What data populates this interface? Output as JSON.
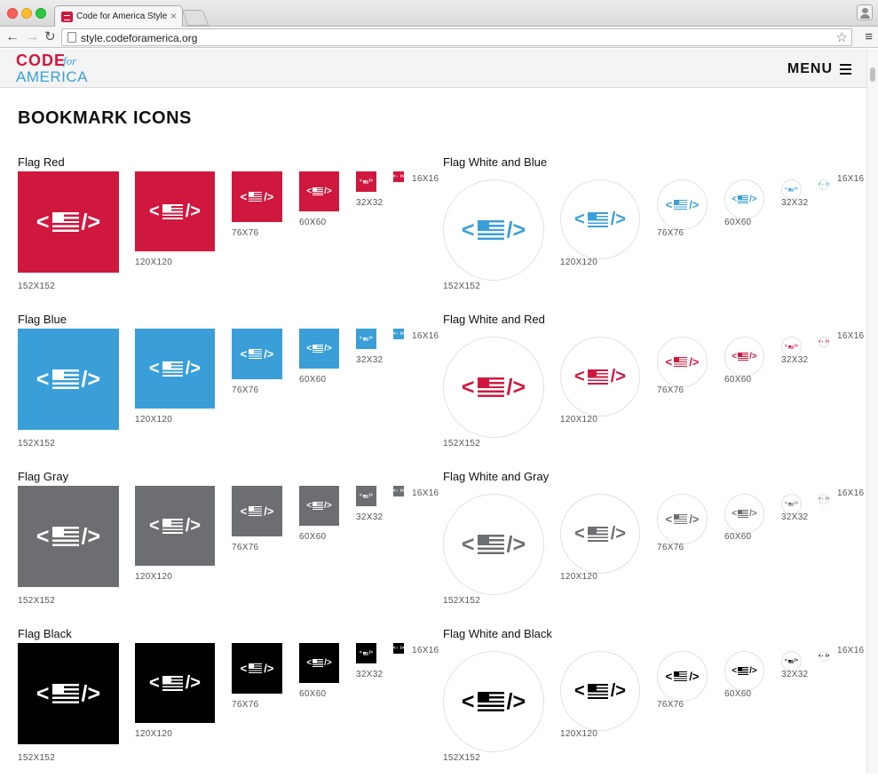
{
  "browser": {
    "tab_title": "Code for America Style Gu",
    "tab_close": "×",
    "url": "style.codeforamerica.org",
    "back": "←",
    "forward": "→",
    "reload": "↻",
    "star": "☆",
    "menu": "≡"
  },
  "site": {
    "logo_code": "CODE",
    "logo_for": "for",
    "logo_america": "AMERICA",
    "menu_label": "MENU"
  },
  "section_title": "BOOKMARK ICONS",
  "colors": {
    "red": "#d0183f",
    "blue": "#3a9fd8",
    "gray": "#6d6e71",
    "black": "#000000",
    "white": "#ffffff"
  },
  "sizes": [
    "152X152",
    "120X120",
    "76X76",
    "60X60",
    "32X32",
    "16X16"
  ],
  "groups": [
    {
      "id": "flag-red",
      "label": "Flag Red",
      "color": "#d0183f",
      "variant": "solid"
    },
    {
      "id": "flag-white-blue",
      "label": "Flag White and Blue",
      "color": "#3a9fd8",
      "variant": "light"
    },
    {
      "id": "flag-blue",
      "label": "Flag Blue",
      "color": "#3a9fd8",
      "variant": "solid"
    },
    {
      "id": "flag-white-red",
      "label": "Flag White and Red",
      "color": "#d0183f",
      "variant": "light"
    },
    {
      "id": "flag-gray",
      "label": "Flag Gray",
      "color": "#6d6e71",
      "variant": "solid"
    },
    {
      "id": "flag-white-gray",
      "label": "Flag White and Gray",
      "color": "#6d6e71",
      "variant": "light"
    },
    {
      "id": "flag-black",
      "label": "Flag Black",
      "color": "#000000",
      "variant": "solid"
    },
    {
      "id": "flag-white-black",
      "label": "Flag White and Black",
      "color": "#000000",
      "variant": "light"
    }
  ]
}
